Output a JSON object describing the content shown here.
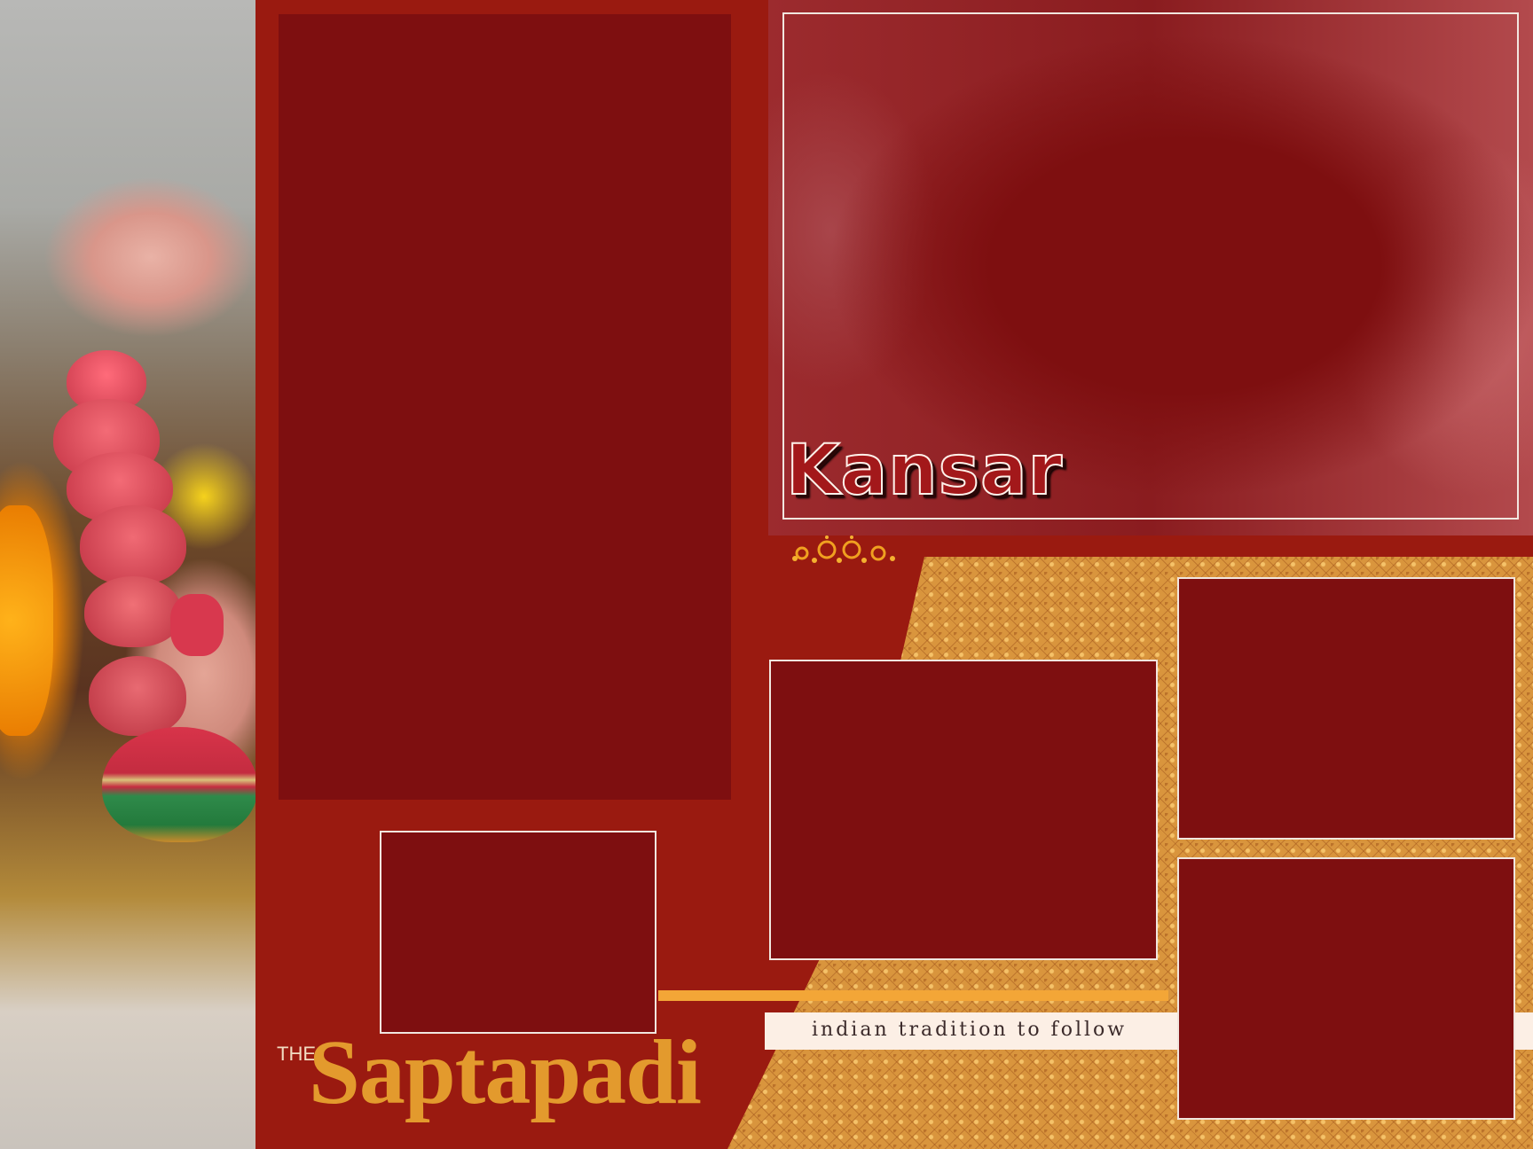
{
  "page": {
    "section_title": "Kansar",
    "title_prefix": "THE",
    "title_main": "Saptapadi",
    "tagline": "indian tradition to follow"
  },
  "colors": {
    "background": "#9a1a10",
    "placeholder": "#7e0f10",
    "frame_border": "#f1e6df",
    "gold_accent": "#f3a637",
    "title_gold": "#e39a2d",
    "pattern_gold": "#d9953d"
  },
  "placeholders": [
    "photo-slot-tall",
    "photo-slot-small",
    "photo-slot-medium",
    "photo-slot-top-right",
    "photo-slot-bottom-right"
  ]
}
